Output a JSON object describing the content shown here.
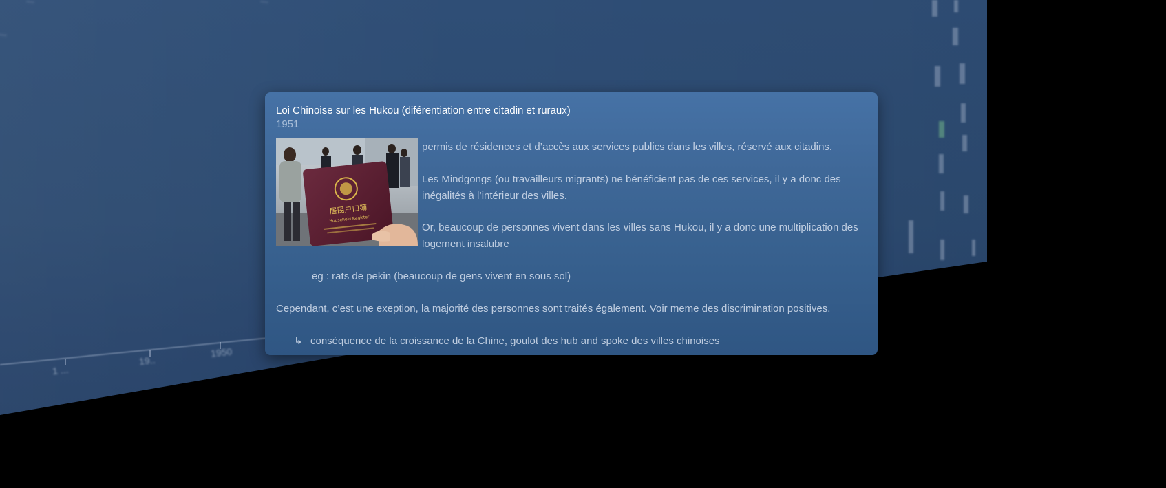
{
  "timeline": {
    "blurred_captions": [
      "...",
      "...",
      "..."
    ],
    "axis_labels": [
      "1 ...",
      "19..",
      "1950"
    ]
  },
  "card": {
    "title": "Loi Chinoise sur les Hukou (diférentiation entre citadin et ruraux)",
    "date": "1951",
    "photo_text_line1": "居民户口簿",
    "photo_text_line2": "Household Register",
    "paragraphs": {
      "p1": "permis de résidences et d’accès aux services publics dans les villes, réservé aux citadins.",
      "p2": "Les Mindgongs (ou travailleurs migrants) ne bénéficient pas de ces services, il y a donc des inégalités à l’intérieur des villes.",
      "p3": "Or, beaucoup de personnes vivent dans les villes sans Hukou, il y a donc une multiplication des logement insalubre",
      "p4": "eg : rats de pekin (beaucoup de gens vivent en sous sol)",
      "p5": "Cependant, c’est une exeption, la majorité des personnes sont traités également. Voir meme des discrimination positives.",
      "p6": "conséquence de la croissance de la Chine, goulot des hub and spoke des villes chinoises"
    },
    "arrow_glyph": "↳"
  },
  "colors": {
    "wall": "#2c4a70",
    "card": "#3f6898",
    "background": "#000000"
  }
}
